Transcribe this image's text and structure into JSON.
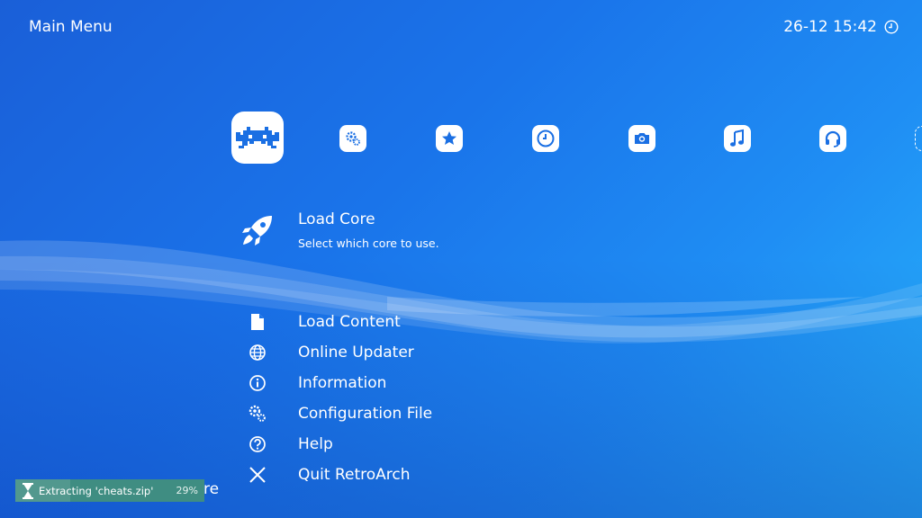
{
  "header": {
    "title": "Main Menu",
    "clock": "26-12 15:42"
  },
  "tabs": [
    {
      "name": "tab-main-menu",
      "icon": "retroarch-invader-icon",
      "active": true
    },
    {
      "name": "tab-settings",
      "icon": "gears-icon"
    },
    {
      "name": "tab-favorites",
      "icon": "star-icon"
    },
    {
      "name": "tab-history",
      "icon": "clock-icon"
    },
    {
      "name": "tab-images",
      "icon": "camera-icon"
    },
    {
      "name": "tab-music",
      "icon": "music-note-icon"
    },
    {
      "name": "tab-netplay",
      "icon": "headset-icon"
    },
    {
      "name": "tab-add",
      "icon": "add-icon"
    }
  ],
  "selected": {
    "label": "Load Core",
    "sublabel": "Select which core to use.",
    "icon": "rocket-icon"
  },
  "menu": {
    "items": [
      {
        "label": "Load Content",
        "icon": "file-icon"
      },
      {
        "label": "Online Updater",
        "icon": "globe-icon"
      },
      {
        "label": "Information",
        "icon": "info-icon"
      },
      {
        "label": "Configuration File",
        "icon": "gears-icon"
      },
      {
        "label": "Help",
        "icon": "help-icon"
      },
      {
        "label": "Quit RetroArch",
        "icon": "close-icon"
      }
    ],
    "partial_item_fragment": "re"
  },
  "status": {
    "text": "Extracting 'cheats.zip'",
    "progress_percent": "29%",
    "progress_value": 0.29,
    "icon": "hourglass-icon"
  },
  "colors": {
    "accent_bg": "#1a74ea",
    "status_bg": "#3f8d82",
    "text": "#ffffff"
  }
}
